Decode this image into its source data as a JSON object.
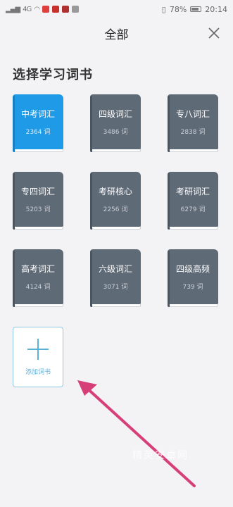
{
  "status_bar": {
    "signal": "4G",
    "battery_percent": "78%",
    "time": "20:14"
  },
  "header": {
    "title": "全部",
    "close_icon": "close-icon"
  },
  "section_title": "选择学习词书",
  "books": [
    {
      "name": "中考词汇",
      "count": "2364 词",
      "selected": true
    },
    {
      "name": "四级词汇",
      "count": "3486 词",
      "selected": false
    },
    {
      "name": "专八词汇",
      "count": "2838 词",
      "selected": false
    },
    {
      "name": "专四词汇",
      "count": "5203 词",
      "selected": false
    },
    {
      "name": "考研核心",
      "count": "2256 词",
      "selected": false
    },
    {
      "name": "考研词汇",
      "count": "6279 词",
      "selected": false
    },
    {
      "name": "高考词汇",
      "count": "4124 词",
      "selected": false
    },
    {
      "name": "六级词汇",
      "count": "3071 词",
      "selected": false
    },
    {
      "name": "四级高频",
      "count": "739 词",
      "selected": false
    }
  ],
  "add_book": {
    "label": "添加词书",
    "icon": "plus-icon"
  },
  "watermark": "精英安卓网",
  "colors": {
    "selected_book": "#1e9ae6",
    "book": "#5f6a77",
    "accent": "#59b0d8",
    "arrow": "#d63f78"
  }
}
